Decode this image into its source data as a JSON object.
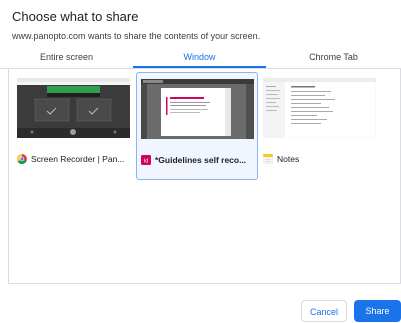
{
  "dialog": {
    "title": "Choose what to share",
    "subtitle": "www.panopto.com wants to share the contents of your screen."
  },
  "tabs": [
    {
      "label": "Entire screen",
      "active": false
    },
    {
      "label": "Window",
      "active": true
    },
    {
      "label": "Chrome Tab",
      "active": false
    }
  ],
  "windows": [
    {
      "label": "Screen Recorder | Pan...",
      "icon": "chrome-icon",
      "selected": false
    },
    {
      "label": "*Guidelines self reco...",
      "icon": "indesign-icon",
      "icon_text": "Id",
      "selected": true
    },
    {
      "label": "Notes",
      "icon": "notes-icon",
      "selected": false
    }
  ],
  "buttons": {
    "cancel": "Cancel",
    "share": "Share"
  },
  "colors": {
    "accent": "#1a73e8",
    "selected_border": "#8ab4f8",
    "indesign": "#d1045f"
  }
}
